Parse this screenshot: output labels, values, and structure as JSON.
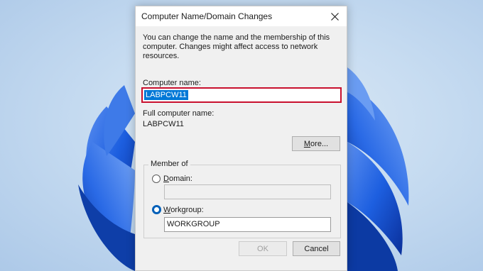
{
  "dialog": {
    "title": "Computer Name/Domain Changes",
    "description": "You can change the name and the membership of this computer. Changes might affect access to network resources.",
    "computer_name_label": "Computer name:",
    "computer_name_value": "LABPCW11",
    "full_name_label": "Full computer name:",
    "full_name_value": "LABPCW11",
    "more_button": {
      "mnemonic": "M",
      "rest": "ore..."
    },
    "member_of": {
      "title": "Member of",
      "domain": {
        "mnemonic": "D",
        "rest": "omain:",
        "value": "",
        "selected": false
      },
      "workgroup": {
        "mnemonic": "W",
        "rest": "orkgroup:",
        "value": "WORKGROUP",
        "selected": true
      }
    },
    "ok_label": "OK",
    "cancel_label": "Cancel"
  },
  "colors": {
    "highlight_border": "#c8102e",
    "selection": "#0078d7",
    "radio_selected": "#005fb8",
    "wallpaper_bloom": "#1453c8"
  },
  "icons": [
    "close-icon",
    "windows-bloom-wallpaper"
  ]
}
